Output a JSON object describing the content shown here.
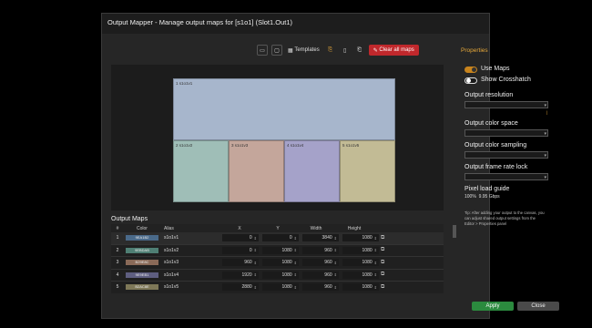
{
  "window": {
    "title": "Output Mapper - Manage output maps for [s1o1] (Slot1.Out1)"
  },
  "toolbar": {
    "templates_label": "Templates",
    "clear_label": "Clear all maps",
    "properties_tab": "Properties"
  },
  "canvas": {
    "ruler_top": "",
    "ruler_left": "",
    "ruler_bottom": "",
    "regions": [
      {
        "label": "1 s1o1v1",
        "color": "#a7b6cc"
      },
      {
        "label": "2 s1o1v2",
        "color": "#9fbeb7"
      },
      {
        "label": "3 s1o1v3",
        "color": "#c4a69b"
      },
      {
        "label": "4 s1o1v4",
        "color": "#a5a2c9"
      },
      {
        "label": "5 s1o1v5",
        "color": "#c2bb95"
      }
    ]
  },
  "maps": {
    "section_label": "Output Maps",
    "headers": {
      "num": "#",
      "color": "Color",
      "alias": "Alias",
      "x": "X",
      "y": "Y",
      "width": "Width",
      "height": "Height"
    },
    "rows": [
      {
        "num": "1",
        "color_hex": "9EA1B2",
        "swatch": "#4a6a8a",
        "alias": "s1o1v1",
        "x": "0",
        "y": "0",
        "width": "3840",
        "height": "1080"
      },
      {
        "num": "2",
        "color_hex": "9EBDAB",
        "swatch": "#4f7f74",
        "alias": "s1o1v2",
        "x": "0",
        "y": "1080",
        "width": "960",
        "height": "1080"
      },
      {
        "num": "3",
        "color_hex": "B29E8C",
        "swatch": "#8a6a58",
        "alias": "s1o1v3",
        "x": "960",
        "y": "1080",
        "width": "960",
        "height": "1080"
      },
      {
        "num": "4",
        "color_hex": "9E9EB1",
        "swatch": "#5e5e80",
        "alias": "s1o1v4",
        "x": "1920",
        "y": "1080",
        "width": "960",
        "height": "1080"
      },
      {
        "num": "5",
        "color_hex": "B2AC8E",
        "swatch": "#7e7858",
        "alias": "s1o1v5",
        "x": "2880",
        "y": "1080",
        "width": "960",
        "height": "1080"
      }
    ]
  },
  "properties": {
    "use_maps_label": "Use Maps",
    "use_maps_on": true,
    "crosshatch_label": "Show Crosshatch",
    "crosshatch_on": false,
    "resolution_label": "Output resolution",
    "resolution_value": "",
    "add_custom": "",
    "manage": "",
    "color_space_label": "Output color space",
    "color_space_value": "",
    "sampling_label": "Output color sampling",
    "sampling_value": "",
    "frame_rate_label": "Output frame rate lock",
    "frame_rate_value": "",
    "pixel_load_label": "Pixel load guide",
    "pixel_load_percent": "100%",
    "pixel_load_rate": "9.95 Gbps",
    "hint": "Tip: After adding your output to the canvas, you can adjust shared output settings from the Editor > Properties panel"
  },
  "footer": {
    "apply_label": "Apply",
    "close_label": "Close"
  }
}
